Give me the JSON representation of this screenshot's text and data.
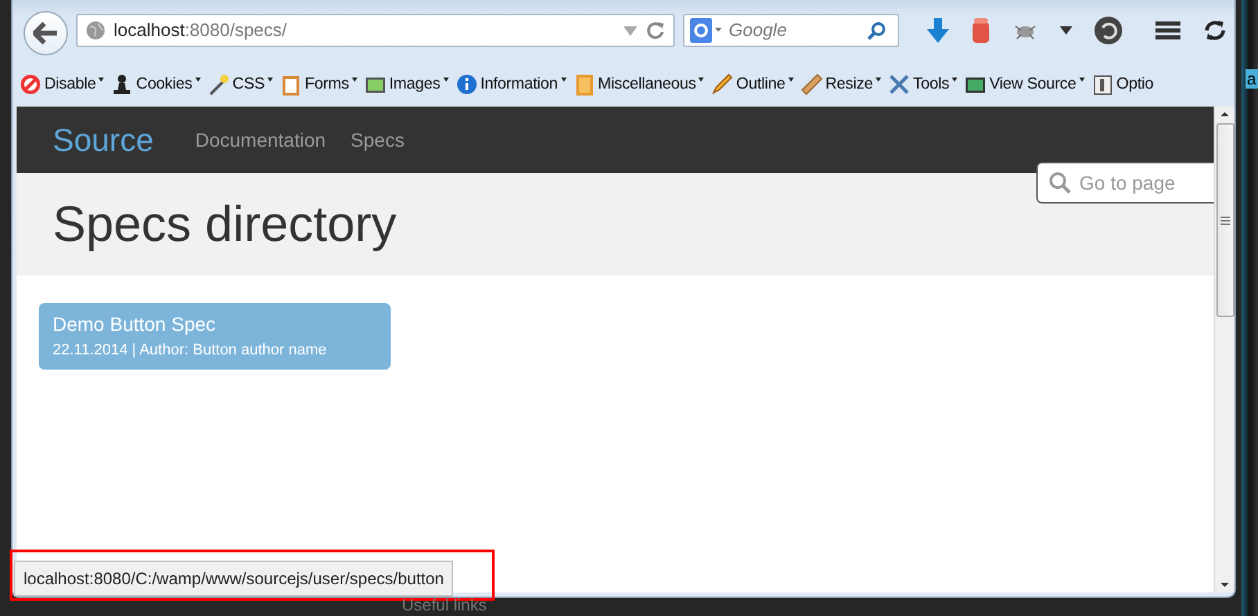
{
  "browser": {
    "address": {
      "host": "localhost",
      "rest": ":8080/specs/"
    },
    "search": {
      "placeholder": "Google"
    },
    "bookmarks": [
      {
        "label": "Disable",
        "kind": "disable",
        "dropdown": true
      },
      {
        "label": "Cookies",
        "kind": "cookies",
        "dropdown": true
      },
      {
        "label": "CSS",
        "kind": "css",
        "dropdown": true
      },
      {
        "label": "Forms",
        "kind": "forms",
        "dropdown": true
      },
      {
        "label": "Images",
        "kind": "images",
        "dropdown": true
      },
      {
        "label": "Information",
        "kind": "information",
        "dropdown": true
      },
      {
        "label": "Miscellaneous",
        "kind": "misc",
        "dropdown": true
      },
      {
        "label": "Outline",
        "kind": "outline",
        "dropdown": true
      },
      {
        "label": "Resize",
        "kind": "resize",
        "dropdown": true
      },
      {
        "label": "Tools",
        "kind": "tools",
        "dropdown": true
      },
      {
        "label": "View Source",
        "kind": "view-source",
        "dropdown": true
      },
      {
        "label": "Optio",
        "kind": "options",
        "dropdown": false
      }
    ]
  },
  "page": {
    "brand": "Source",
    "nav": [
      {
        "label": "Documentation"
      },
      {
        "label": "Specs"
      }
    ],
    "search": {
      "placeholder": "Go to page"
    },
    "title": "Specs directory",
    "specs": [
      {
        "title": "Demo Button Spec",
        "meta": "22.11.2014 | Author: Button author name"
      }
    ]
  },
  "status_bar": {
    "text": "localhost:8080/C:/wamp/www/sourcejs/user/specs/button"
  },
  "background": {
    "window_text": "a",
    "footer_text": "Useful links"
  }
}
